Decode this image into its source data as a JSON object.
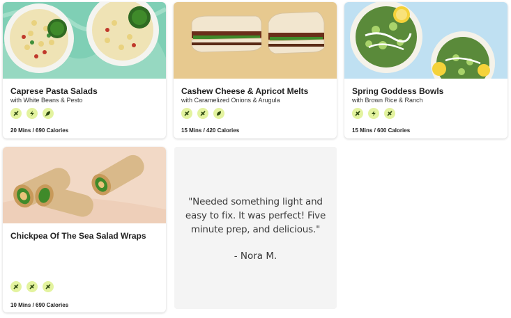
{
  "recipes": [
    {
      "title": "Caprese Pasta Salads",
      "subtitle": "with White Beans & Pesto",
      "meta": "20 Mins / 690 Calories",
      "badges": [
        "nut-free-icon",
        "quick-icon",
        "vegan-icon"
      ],
      "image": "pasta-salad-bowls-image",
      "bg": "#7fcfb5"
    },
    {
      "title": "Cashew Cheese & Apricot Melts",
      "subtitle": "with Caramelized Onions & Arugula",
      "meta": "15 Mins / 420 Calories",
      "badges": [
        "nut-free-icon",
        "quick-icon",
        "vegan-icon"
      ],
      "image": "sandwich-melts-image",
      "bg": "#e7c98f"
    },
    {
      "title": "Spring Goddess Bowls",
      "subtitle": "with Brown Rice & Ranch",
      "meta": "15 Mins / 600 Calories",
      "badges": [
        "nut-free-icon",
        "quick-icon",
        "vegan-icon"
      ],
      "image": "grain-bowls-image",
      "bg": "#bfe0f2"
    },
    {
      "title": "Chickpea Of The Sea Salad Wraps",
      "subtitle": "",
      "meta": "10 Mins / 690 Calories",
      "badges": [
        "nut-free-icon",
        "vegan-icon",
        "vegan-icon"
      ],
      "image": "wraps-image",
      "bg": "#f2d9c6"
    }
  ],
  "testimonial": {
    "text": "\"Needed something light and easy to fix. It was perfect! Five minute prep, and delicious.\"",
    "author": "- Nora M."
  },
  "colors": {
    "badge_bg": "#e3f39f",
    "badge_fg": "#2f4a12"
  }
}
